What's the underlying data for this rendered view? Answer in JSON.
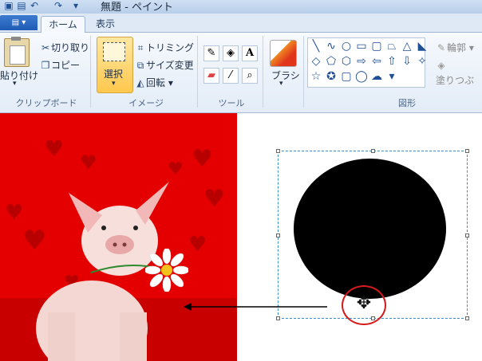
{
  "window": {
    "title": "無題 - ペイント"
  },
  "quick_access": [
    "save-icon",
    "undo-icon",
    "redo-icon",
    "customize-icon"
  ],
  "tabs": {
    "file": "▤ ▾",
    "home": "ホーム",
    "view": "表示"
  },
  "clipboard": {
    "paste": "貼り付け",
    "paste_arrow": "▾",
    "cut": "切り取り",
    "copy": "コピー",
    "group": "クリップボード"
  },
  "image": {
    "select": "選択",
    "select_arrow": "▾",
    "crop": "トリミング",
    "resize": "サイズ変更",
    "rotate": "回転 ▾",
    "group": "イメージ"
  },
  "tools": {
    "group": "ツール"
  },
  "brush": {
    "label": "ブラシ",
    "arrow": "▾"
  },
  "shapes": {
    "group": "図形",
    "outline": "輪郭 ▾",
    "fill": "塗りつぶ",
    "gallery": [
      "╲",
      "∿",
      "○",
      "▭",
      "▢",
      "⏢",
      "△",
      "◣",
      "◇",
      "⬠",
      "⬡",
      "⇨",
      "⇦",
      "⇧",
      "⇩",
      "✧",
      "☆",
      "✪",
      "▢",
      "◯",
      "☁",
      "▾"
    ]
  },
  "colors": {
    "photo_red": "#e40000",
    "selection_blue": "#3a8fcb",
    "highlight_red": "#d41a1a"
  }
}
